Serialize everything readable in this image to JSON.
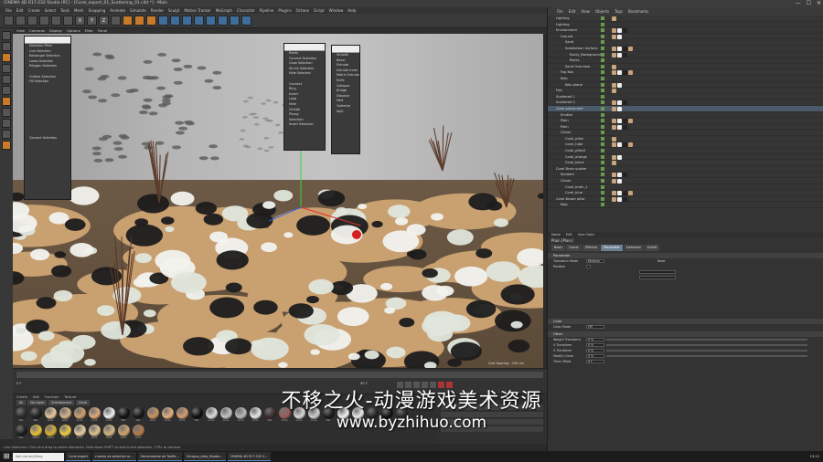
{
  "window": {
    "title": "CINEMA 4D R17.032 Studio (RC) - [Coral_export_01_Scattering_01.c4d *] - Main",
    "controls": [
      "—",
      "☐",
      "✕"
    ]
  },
  "menubar": [
    "File",
    "Edit",
    "Create",
    "Select",
    "Tools",
    "Mesh",
    "Snapping",
    "Animate",
    "Simulate",
    "Render",
    "Sculpt",
    "Motion Tracker",
    "MoGraph",
    "Character",
    "Pipeline",
    "Plugins",
    "Octane",
    "Script",
    "Window",
    "Help"
  ],
  "toolbar": {
    "buttons": [
      "undo",
      "redo",
      "select",
      "move",
      "scale",
      "rotate",
      "X",
      "Y",
      "Z",
      "coord",
      "render-view",
      "render",
      "render-settings",
      "cube",
      "pen",
      "subdivide",
      "array",
      "deformer",
      "floor",
      "camera",
      "light"
    ]
  },
  "viewport": {
    "menu": [
      "View",
      "Cameras",
      "Display",
      "Options",
      "Filter",
      "Panel"
    ],
    "label": "Perspective",
    "grid_spacing": "Grid Spacing : 100 cm"
  },
  "popup_left": {
    "items": [
      "Selection Filter",
      "Live Selection",
      "Rectangle Selection",
      "Lasso Selection",
      "Polygon Selection",
      "",
      "Outline Selection",
      "Fill Selection",
      "",
      "",
      "",
      "",
      "",
      "",
      "",
      "",
      "",
      "",
      "Convert Selection"
    ]
  },
  "popup_mid": {
    "items": [
      "Points",
      "Convert Selection",
      "Grow Selection",
      "Shrink Selection",
      "Hide Selected",
      "",
      "Connect",
      "Ring",
      "Invert",
      "Loop",
      "Hide",
      "Unhide",
      "Phong",
      "Selection",
      "Invert Selection"
    ]
  },
  "popup_right": {
    "items": [
      "Smooth",
      "Bevel",
      "Extrude",
      "Extrude Inner",
      "Matrix Extrude",
      "Knife",
      "Collapse",
      "Bridge",
      "Dissolve",
      "Melt",
      "Optimize",
      "Split"
    ]
  },
  "timeline": {
    "frame_start": "0 F",
    "frame_end": "90 F",
    "current": "0 F"
  },
  "material_manager": {
    "menu": [
      "Create",
      "Edit",
      "Function",
      "Texture"
    ],
    "tabs": [
      "All",
      "No Layer",
      "Environment",
      "Coral"
    ],
    "materials": [
      {
        "name": "Mat",
        "color": "#2a2a2a"
      },
      {
        "name": "Mat",
        "color": "#1e1e1e"
      },
      {
        "name": "Sand",
        "color": "#e8c89a"
      },
      {
        "name": "Sand",
        "color": "#d9b488"
      },
      {
        "name": "Coral",
        "color": "#d2a070"
      },
      {
        "name": "Coral",
        "color": "#e0a87a"
      },
      {
        "name": "Coral",
        "color": "#f0f0f0"
      },
      {
        "name": "Mat",
        "color": "#111111"
      },
      {
        "name": "Mat",
        "color": "#151515"
      },
      {
        "name": "Sand",
        "color": "#c9955f"
      },
      {
        "name": "Coral",
        "color": "#e6b07c"
      },
      {
        "name": "Coral",
        "color": "#d89c6a"
      },
      {
        "name": "Mat",
        "color": "#0e0e0e"
      },
      {
        "name": "Coral",
        "color": "#dcdcdc"
      },
      {
        "name": "Coral",
        "color": "#c4c4c4"
      },
      {
        "name": "Coral",
        "color": "#b8b8b8"
      },
      {
        "name": "Coral",
        "color": "#e8e8e8"
      },
      {
        "name": "Mat",
        "color": "#3a2a2a"
      },
      {
        "name": "Coral",
        "color": "#a05a5a"
      },
      {
        "name": "Coral",
        "color": "#d8d8d8"
      },
      {
        "name": "Coral",
        "color": "#cfcfcf"
      },
      {
        "name": "Mat",
        "color": "#1a1a1a"
      },
      {
        "name": "Coral",
        "color": "#f2f2f2"
      },
      {
        "name": "Coral",
        "color": "#ececec"
      },
      {
        "name": "Mat",
        "color": "#222222"
      },
      {
        "name": "Mat",
        "color": "#101010"
      },
      {
        "name": "Mat",
        "color": "#252525"
      },
      {
        "name": "Mat",
        "color": "#181818"
      }
    ],
    "row2": [
      {
        "name": "Mat",
        "color": "#1a1a1a"
      },
      {
        "name": "Yellow",
        "color": "#e8c33a"
      },
      {
        "name": "Yellow",
        "color": "#d9b234"
      },
      {
        "name": "Yellow",
        "color": "#f0cd45"
      },
      {
        "name": "Sand",
        "color": "#e8d0a0"
      },
      {
        "name": "Sand",
        "color": "#dfc48e"
      },
      {
        "name": "Sand",
        "color": "#d4b882"
      },
      {
        "name": "Sand",
        "color": "#cfa56c"
      },
      {
        "name": "Sand",
        "color": "#b47c4c"
      }
    ]
  },
  "statusbar": {
    "text": "Live Selection: Click and drag to select elements. Hold down SHIFT to add to the selection, CTRL to remove."
  },
  "taskbar": {
    "search": "Ask me anything",
    "tasks": [
      "Coral export",
      "cinema ae selection m...",
      "Gemeinsame de Tarifle...",
      "Octopus_data_Shader...",
      "CINEMA 4D R17.032 S..."
    ],
    "clock": "13:12"
  },
  "object_manager": {
    "menu": [
      "File",
      "Edit",
      "View",
      "Objects",
      "Tags",
      "Bookmarks"
    ],
    "rows": [
      {
        "name": "Lighting",
        "indent": 1
      },
      {
        "name": "Lighting",
        "indent": 1
      },
      {
        "name": "Environment",
        "indent": 1
      },
      {
        "name": "Ground",
        "indent": 2
      },
      {
        "name": "Sand",
        "indent": 3
      },
      {
        "name": "Subdivision Surface",
        "indent": 3
      },
      {
        "name": "Rocky_Background",
        "indent": 4
      },
      {
        "name": "Rocks",
        "indent": 4
      },
      {
        "name": "Sand Overview",
        "indent": 3
      },
      {
        "name": "Fog Box",
        "indent": 2
      },
      {
        "name": "Kelp",
        "indent": 2
      },
      {
        "name": "Kelp plane",
        "indent": 3
      },
      {
        "name": "Fish",
        "indent": 1
      },
      {
        "name": "Scattered 1",
        "indent": 1
      },
      {
        "name": "Scattered 2",
        "indent": 1
      },
      {
        "name": "Coral placement",
        "indent": 1,
        "sel": true
      },
      {
        "name": "Emitter",
        "indent": 2
      },
      {
        "name": "Plain",
        "indent": 2
      },
      {
        "name": "Plain",
        "indent": 2
      },
      {
        "name": "Cloner",
        "indent": 2
      },
      {
        "name": "Coral_pillar",
        "indent": 3
      },
      {
        "name": "Coral_tube",
        "indent": 3
      },
      {
        "name": "Coral_pillar2",
        "indent": 3
      },
      {
        "name": "Coral_orange",
        "indent": 3
      },
      {
        "name": "Coral_black",
        "indent": 3
      },
      {
        "name": "Coral Brain scatter",
        "indent": 1
      },
      {
        "name": "Random",
        "indent": 2
      },
      {
        "name": "Cloner",
        "indent": 2
      },
      {
        "name": "Coral_brain_1",
        "indent": 3
      },
      {
        "name": "Coral_blue",
        "indent": 3
      },
      {
        "name": "Coral Brown pillar",
        "indent": 1
      },
      {
        "name": "Kelp",
        "indent": 2
      }
    ]
  },
  "attribute_manager": {
    "modes": [
      "Mode",
      "Edit",
      "User Data"
    ],
    "title": "Plain [Plain]",
    "tabs": [
      "Basic",
      "Coord.",
      "Effector",
      "Parameter",
      "Deformer",
      "Falloff"
    ],
    "active_tab": "Parameter",
    "sections": [
      {
        "title": "Parameter",
        "rows": [
          "Transform Mode",
          "Position",
          "",
          ""
        ]
      },
      {
        "title": "Color",
        "rows": [
          "Color Mode"
        ]
      },
      {
        "title": "Other",
        "rows": [
          "Weight Transform",
          "U Transform",
          "V Transform",
          "Modify Clone",
          "Time Offset"
        ]
      }
    ],
    "values": {
      "transform_mode": "Relative",
      "transform_space": "Node",
      "color_mode": "Off",
      "weight": "0 %",
      "u": "0 %",
      "v": "0 %",
      "clone": "0 %",
      "time": "0 F"
    }
  },
  "watermark": {
    "cn": "不移之火-动漫游戏美术资源",
    "url": "www.byzhihuo.com"
  }
}
